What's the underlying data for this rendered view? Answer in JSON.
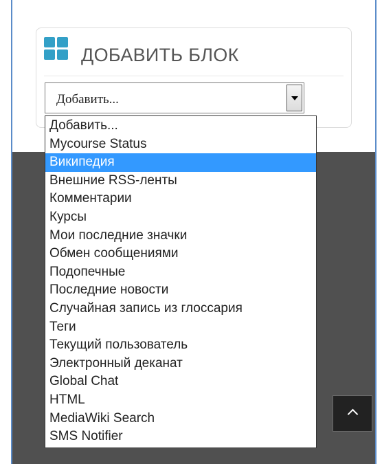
{
  "add_block": {
    "title": "ДОБАВИТЬ БЛОК",
    "icon": "blocks-grid-icon",
    "icon_color": "#33a0c7",
    "select": {
      "value": "Добавить...",
      "options": [
        "Добавить...",
        "Mycourse Status",
        "Википедия",
        "Внешние RSS-ленты",
        "Комментарии",
        "Курсы",
        "Мои последние значки",
        "Обмен сообщениями",
        "Подопечные",
        "Последние новости",
        "Случайная запись из глоссария",
        "Теги",
        "Текущий пользователь",
        "Электронный деканат",
        "Global Chat",
        "HTML",
        "MediaWiki Search",
        "SMS Notifier"
      ],
      "highlighted_index": 2
    }
  },
  "back_to_top": {
    "icon": "chevron-up-icon"
  },
  "colors": {
    "highlight": "#3399ff",
    "footer": "#505050",
    "frame_border": "#5b8cc9"
  }
}
